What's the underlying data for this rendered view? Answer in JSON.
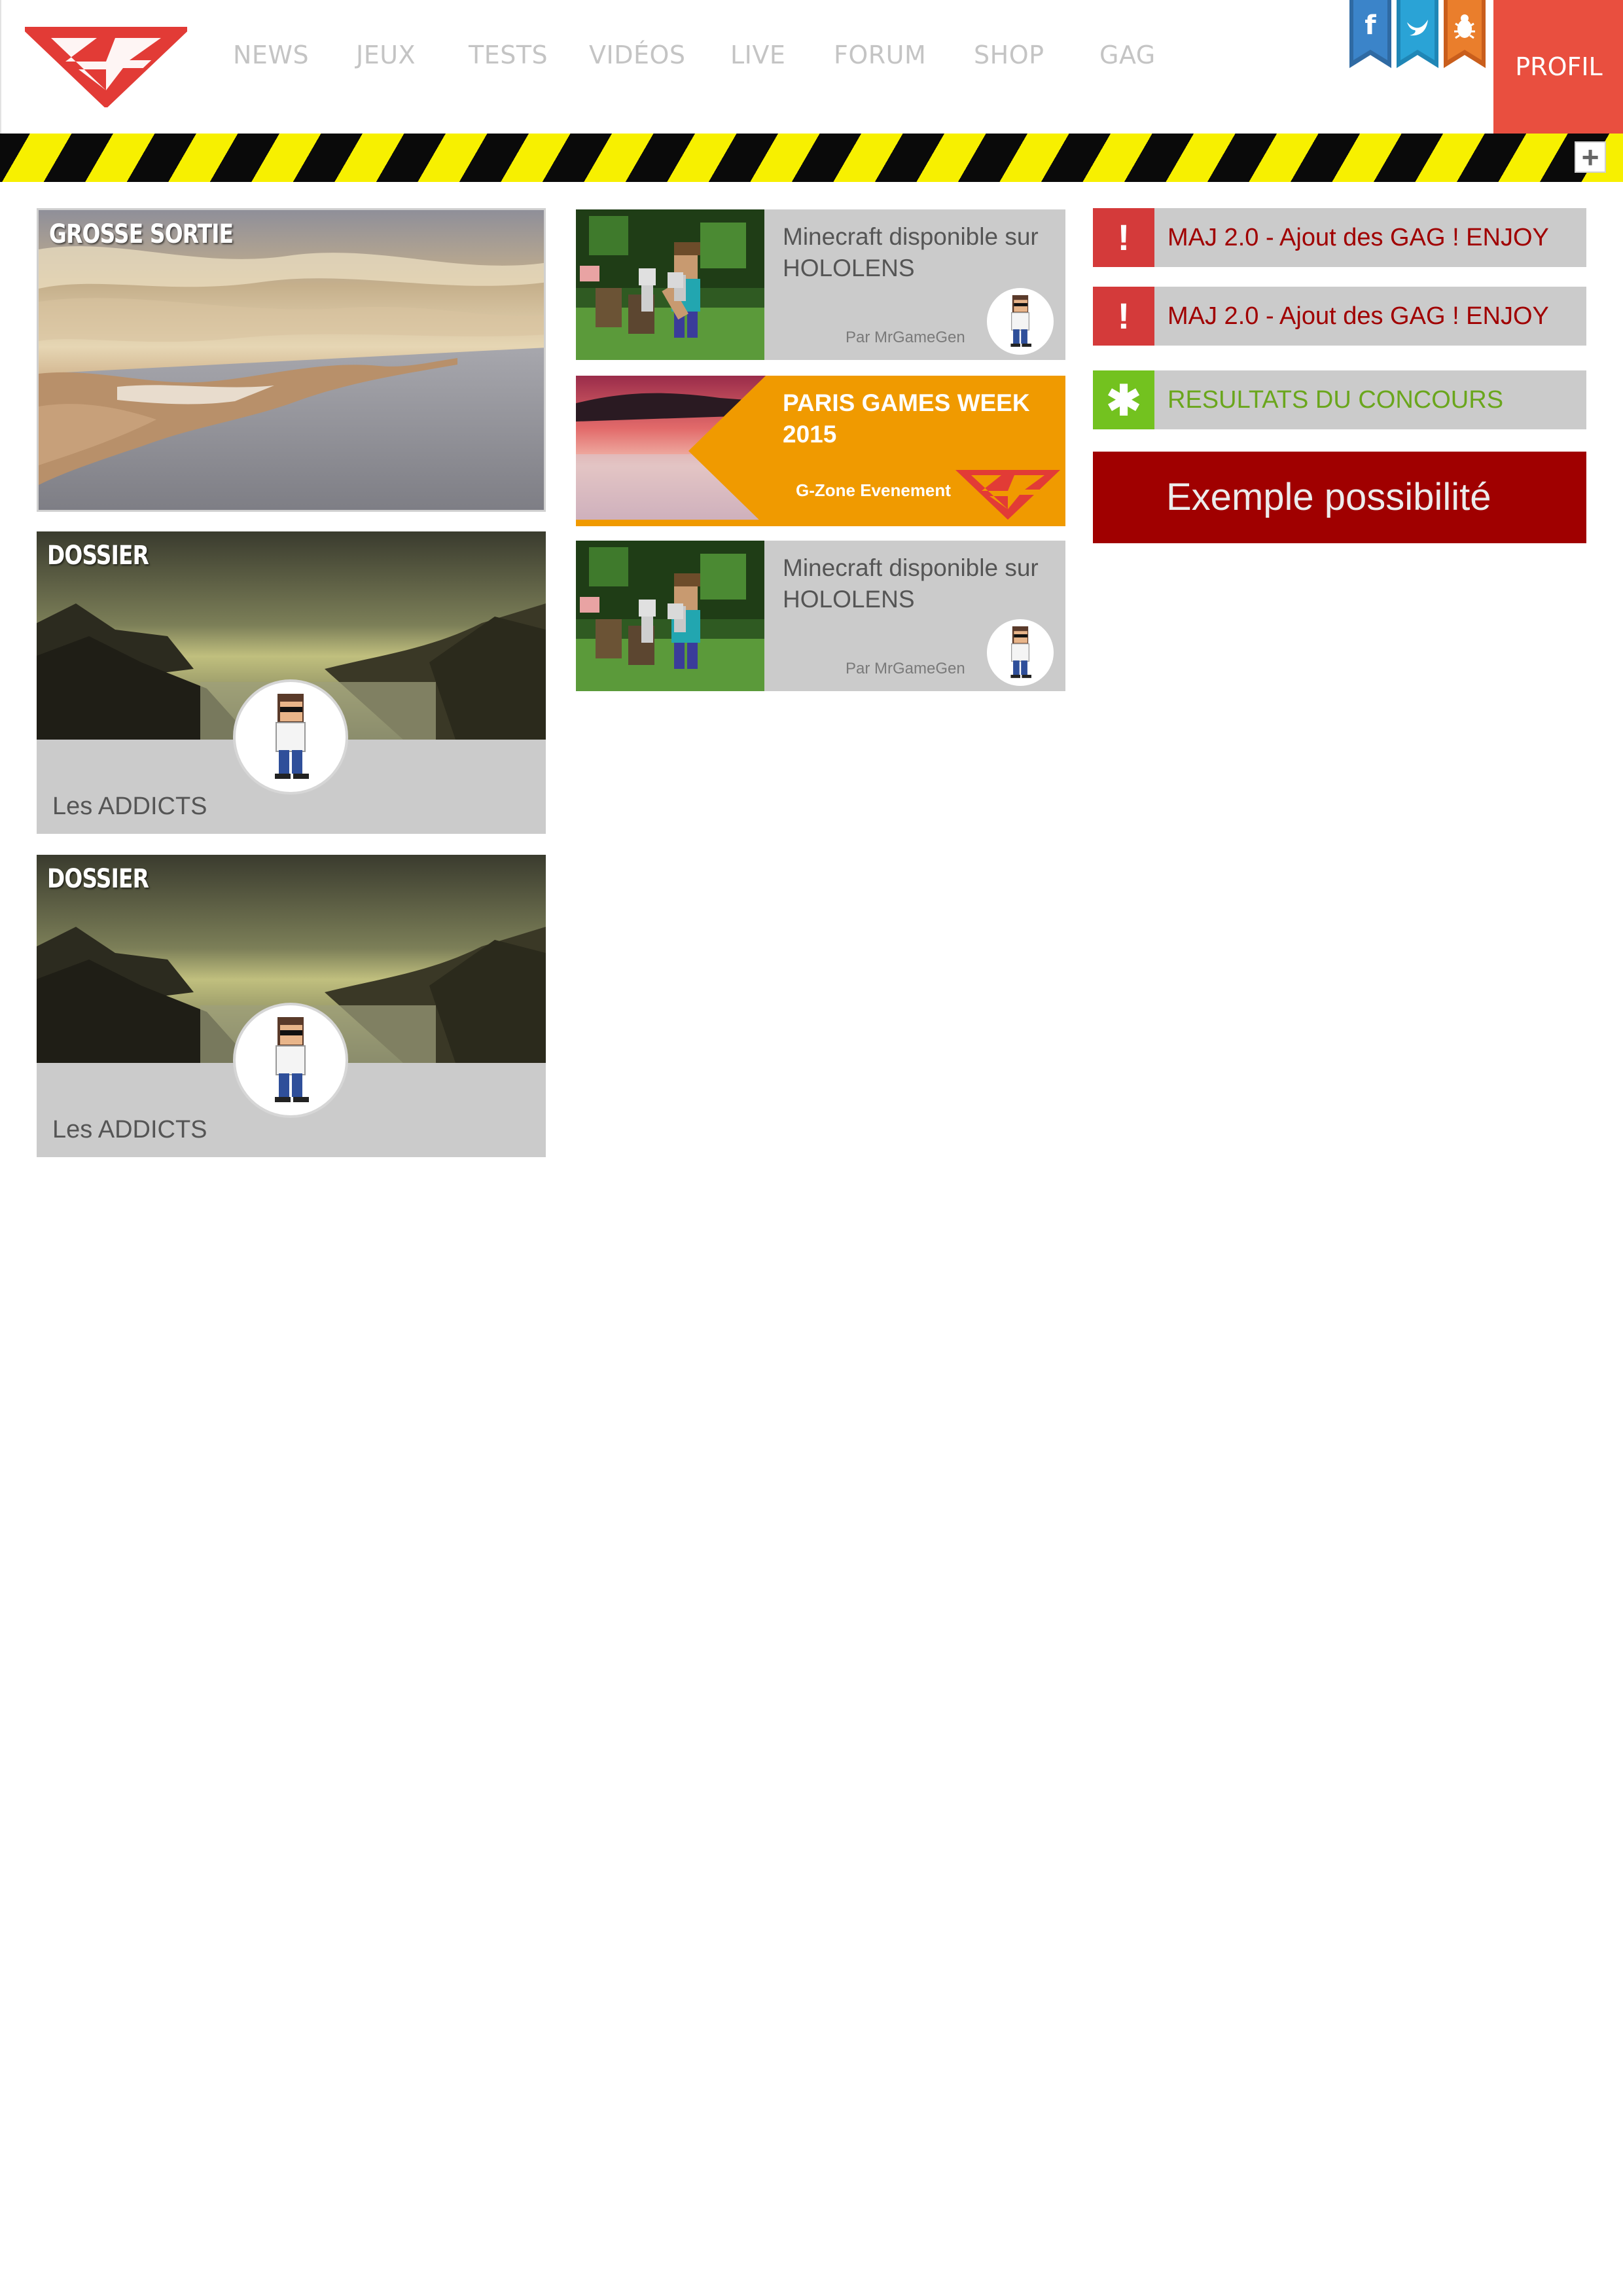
{
  "brand": {
    "accent": "#e94f3f",
    "nav_color": "#c4c4c4",
    "hazard_yellow": "#f7f000",
    "hazard_black": "#0a0a0a"
  },
  "header": {
    "nav": [
      "NEWS",
      "JEUX",
      "TESTS",
      "VIDÉOS",
      "LIVE",
      "FORUM",
      "SHOP",
      "GAG"
    ],
    "social": [
      {
        "icon": "facebook-icon",
        "glyph": "f",
        "color": "#3b78b3"
      },
      {
        "icon": "twitter-icon",
        "glyph": "t",
        "color": "#2a9fd0"
      },
      {
        "icon": "bug-icon",
        "glyph": "✱",
        "color": "#e2742a"
      }
    ],
    "profil": "PROFIL",
    "plus": "+"
  },
  "left": {
    "hero_tag": "GROSSE SORTIE",
    "dossiers": [
      {
        "tag": "DOSSIER",
        "title": "Les ADDICTS"
      },
      {
        "tag": "DOSSIER",
        "title": "Les ADDICTS"
      }
    ]
  },
  "middle": {
    "posts": [
      {
        "title": "Minecraft disponible sur HOLOLENS",
        "author": "Par MrGameGen"
      },
      {
        "title": "Minecraft disponible sur HOLOLENS",
        "author": "Par MrGameGen"
      }
    ],
    "event": {
      "title": "PARIS GAMES WEEK 2015",
      "subtitle": "G-Zone Evenement",
      "color": "#f09a00"
    }
  },
  "right": {
    "alerts": [
      {
        "icon": "!",
        "text": "MAJ 2.0 - Ajout des GAG ! ENJOY",
        "icon_bg": "#d43a3a",
        "text_color": "#a00000"
      },
      {
        "icon": "!",
        "text": "MAJ 2.0 - Ajout des GAG ! ENJOY",
        "icon_bg": "#d43a3a",
        "text_color": "#a00000"
      },
      {
        "icon": "✱",
        "text": "RESULTATS DU CONCOURS",
        "icon_bg": "#73c21f",
        "text_color": "#6aa61c"
      }
    ],
    "cta": "Exemple possibilité"
  }
}
